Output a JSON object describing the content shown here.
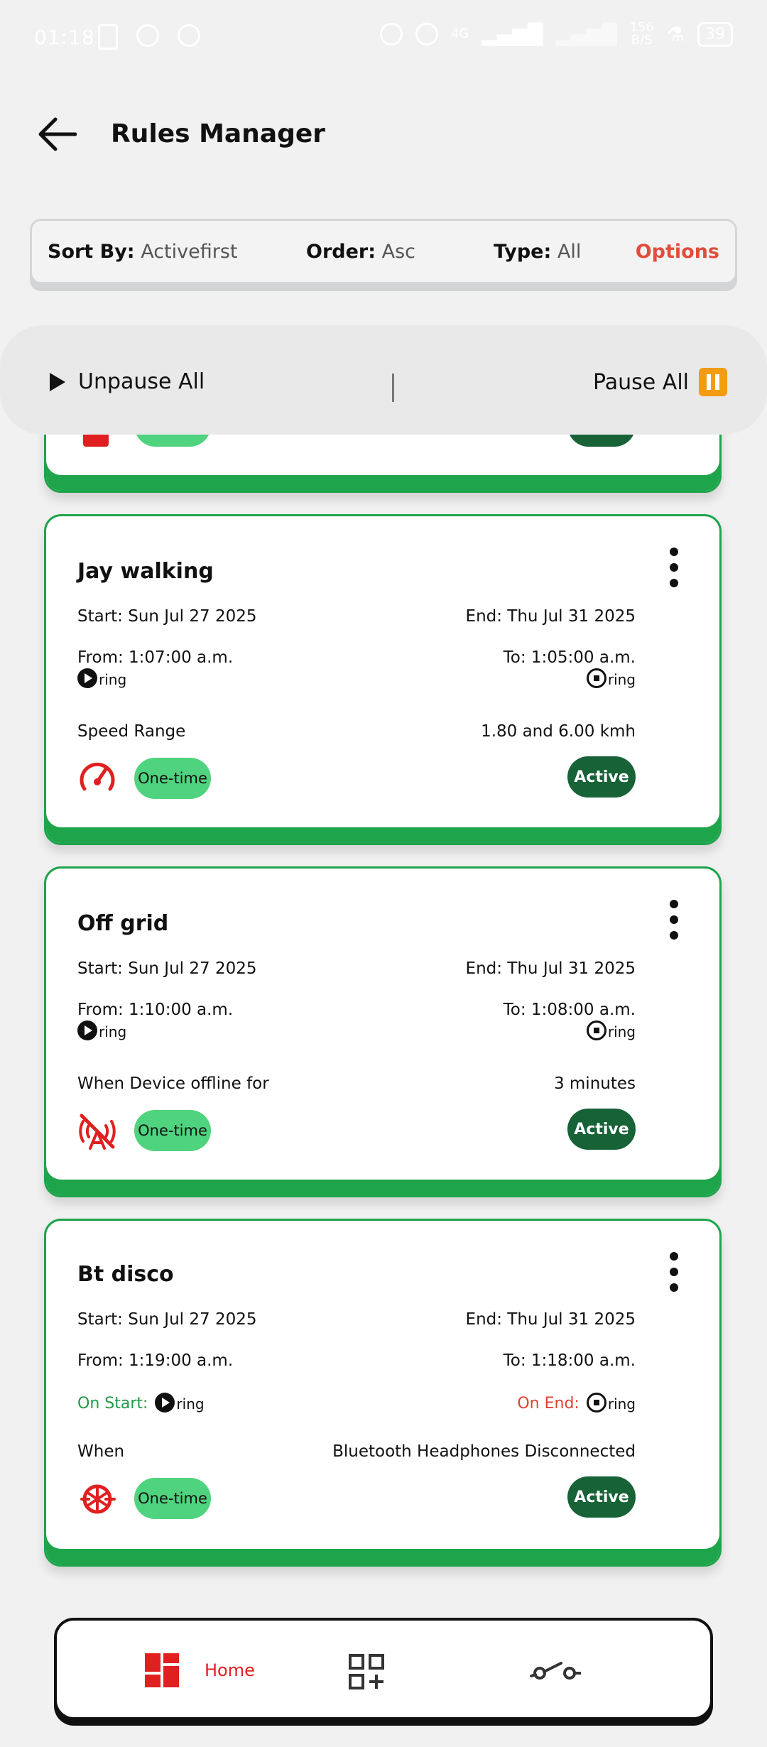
{
  "status_bar": {
    "time": "01:18",
    "net_speed_value": "156",
    "net_speed_unit": "B/S",
    "battery": "39",
    "network": "4G"
  },
  "header": {
    "title": "Rules Manager"
  },
  "sort_bar": {
    "sort_label": "Sort By:",
    "sort_value": "Activefirst",
    "order_label": "Order:",
    "order_value": "Asc",
    "type_label": "Type:",
    "type_value": "All",
    "options_label": "Options"
  },
  "pause_bar": {
    "unpause_label": "Unpause All",
    "pause_label": "Pause All"
  },
  "cards": [
    {
      "name": "Jay walking",
      "start": "Start: Sun Jul 27 2025",
      "end": "End: Thu Jul 31 2025",
      "from": "From: 1:07:00 a.m.",
      "to": "To: 1:05:00 a.m.",
      "from_ring": "ring",
      "to_ring": "ring",
      "condition_label": "Speed Range",
      "condition_value": "1.80 and 6.00 kmh",
      "frequency": "One-time",
      "status": "Active",
      "icon": "speedometer-icon"
    },
    {
      "name": "Off grid",
      "start": "Start: Sun Jul 27 2025",
      "end": "End: Thu Jul 31 2025",
      "from": "From: 1:10:00 a.m.",
      "to": "To: 1:08:00 a.m.",
      "from_ring": "ring",
      "to_ring": "ring",
      "condition_label": "When Device offline for",
      "condition_value": "3 minutes",
      "frequency": "One-time",
      "status": "Active",
      "icon": "offline-icon"
    },
    {
      "name": "Bt disco",
      "start": "Start: Sun Jul 27 2025",
      "end": "End: Thu Jul 31 2025",
      "from": "From: 1:19:00 a.m.",
      "to": "To: 1:18:00 a.m.",
      "on_start_label": "On Start:",
      "on_end_label": "On End:",
      "from_ring": "ring",
      "to_ring": "ring",
      "condition_label": "When",
      "condition_value": "Bluetooth Headphones Disconnected",
      "frequency": "One-time",
      "status": "Active",
      "icon": "bluetooth-disconnect-icon"
    }
  ],
  "bottom_nav": {
    "home_label": "Home"
  },
  "colors": {
    "accent_green": "#1ea44b",
    "active_badge": "#176237",
    "onetime_badge": "#4fd37e",
    "icon_red": "#e02020",
    "options_red": "#e24c3a",
    "pause_orange": "#f39c12"
  }
}
